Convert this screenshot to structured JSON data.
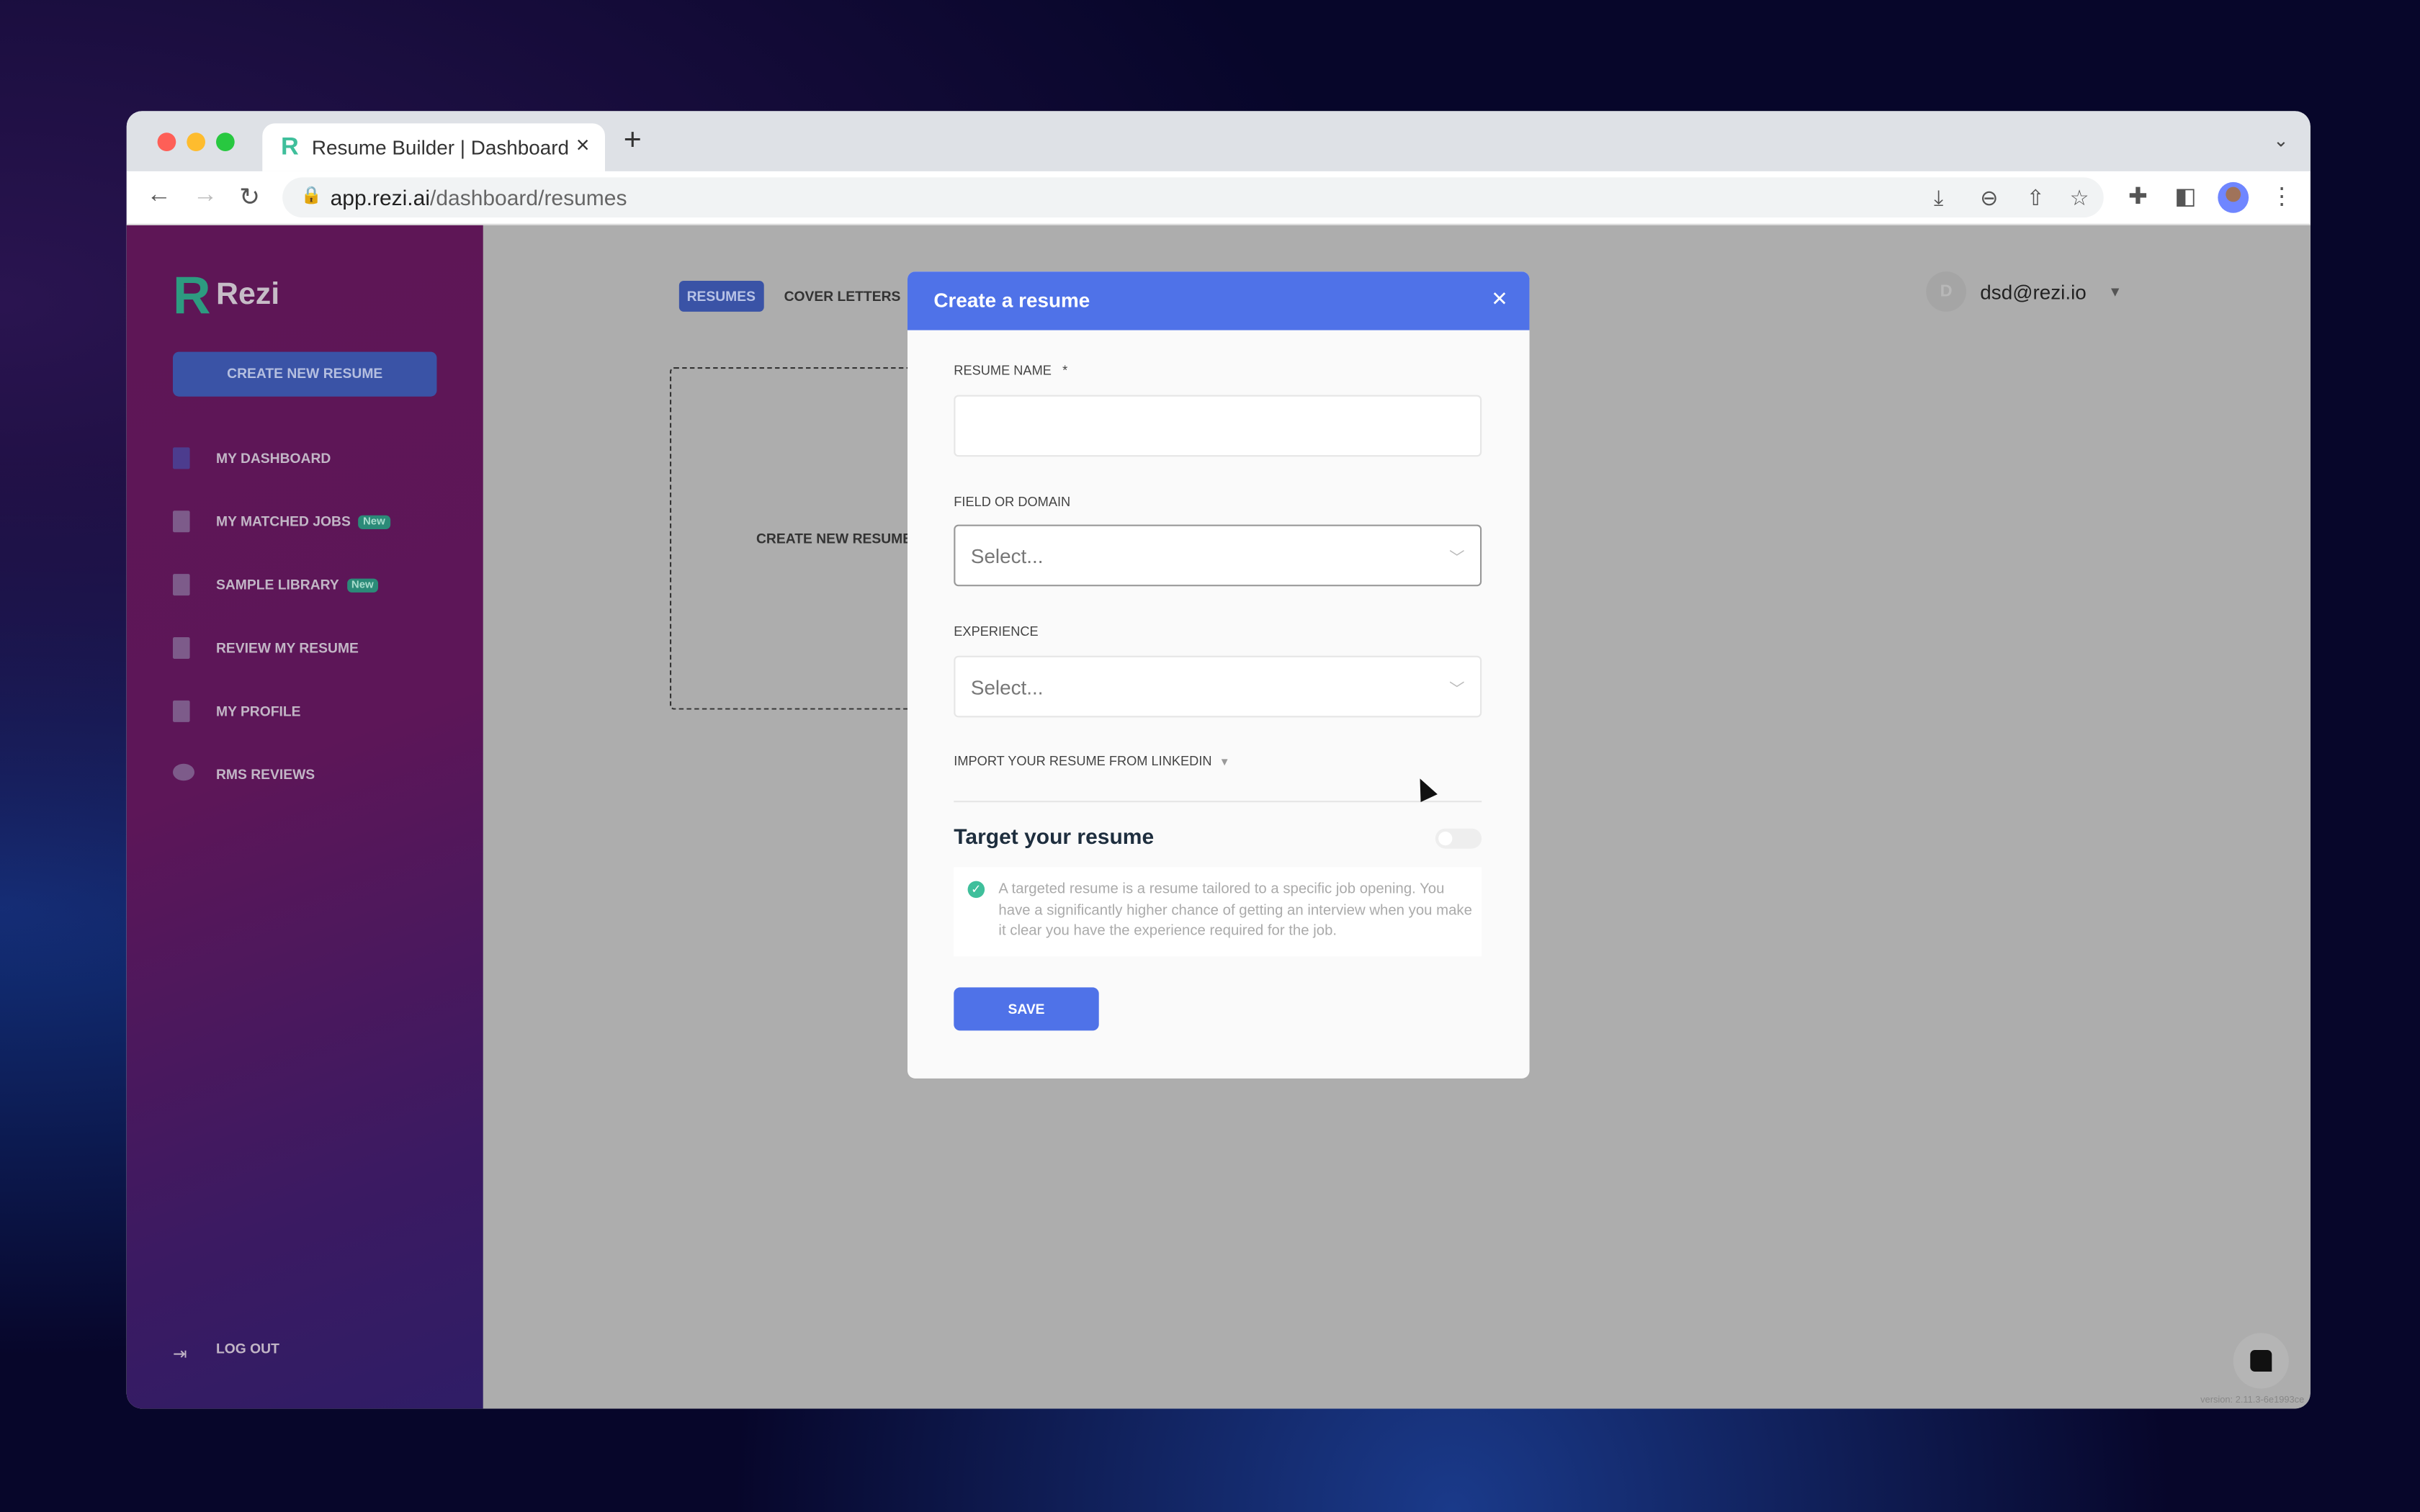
{
  "browser": {
    "tab_title": "Resume Builder | Dashboard",
    "tab_favicon": "R",
    "url_host": "app.rezi.ai",
    "url_path": "/dashboard/resumes"
  },
  "sidebar": {
    "brand": "Rezi",
    "create_button": "CREATE NEW RESUME",
    "items": [
      {
        "label": "MY DASHBOARD",
        "icon": "document-icon"
      },
      {
        "label": "MY MATCHED JOBS",
        "badge": "New",
        "icon": "heart-document-icon"
      },
      {
        "label": "SAMPLE LIBRARY",
        "badge": "New",
        "icon": "list-document-icon"
      },
      {
        "label": "REVIEW MY RESUME",
        "icon": "check-document-icon"
      },
      {
        "label": "MY PROFILE",
        "icon": "profile-document-icon"
      },
      {
        "label": "RMS REVIEWS",
        "icon": "chat-bubbles-icon"
      }
    ],
    "logout": "LOG OUT"
  },
  "main": {
    "tabs": [
      {
        "label": "RESUMES",
        "active": true
      },
      {
        "label": "COVER LETTERS",
        "active": false
      }
    ],
    "create_card": "CREATE NEW RESUME",
    "user": {
      "initial": "D",
      "email": "dsd@rezi.io"
    },
    "version": "version: 2.11.3-6e1993ce"
  },
  "modal": {
    "title": "Create a resume",
    "resume_name_label": "RESUME NAME",
    "required_mark": "*",
    "resume_name_value": "",
    "field_label": "FIELD OR DOMAIN",
    "field_placeholder": "Select...",
    "experience_label": "EXPERIENCE",
    "experience_placeholder": "Select...",
    "linkedin_label": "IMPORT YOUR RESUME FROM LINKEDIN",
    "target_title": "Target your resume",
    "target_enabled": false,
    "target_info": "A targeted resume is a resume tailored to a specific job opening. You have a significantly higher chance of getting an interview when you make it clear you have the experience required for the job.",
    "save_label": "SAVE"
  },
  "colors": {
    "accent": "#4f72e8",
    "brand_green": "#3fbf9b",
    "sidebar": "#5e1656"
  }
}
